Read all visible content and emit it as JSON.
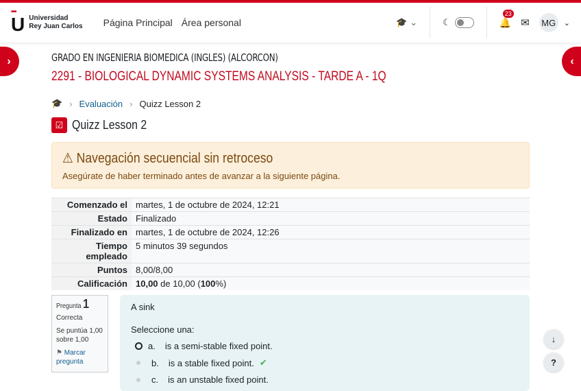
{
  "nav": {
    "logo_line1": "Universidad",
    "logo_line2": "Rey Juan Carlos",
    "links": [
      "Página Principal",
      "Área personal"
    ],
    "notifications": "23",
    "user_initials": "MG"
  },
  "header": {
    "degree": "GRADO EN INGENIERIA BIOMEDICA (INGLES) (ALCORCON)",
    "course": "2291 - BIOLOGICAL DYNAMIC SYSTEMS ANALYSIS - TARDE A - 1Q"
  },
  "breadcrumb": {
    "items": [
      "Evaluación",
      "Quizz Lesson 2"
    ]
  },
  "page_title": "Quizz Lesson 2",
  "alert": {
    "title": "Navegación secuencial sin retroceso",
    "text": "Asegúrate de haber terminado antes de avanzar a la siguiente página."
  },
  "summary": [
    {
      "label": "Comenzado el",
      "value": "martes, 1 de octubre de 2024, 12:21"
    },
    {
      "label": "Estado",
      "value": "Finalizado"
    },
    {
      "label": "Finalizado en",
      "value": "martes, 1 de octubre de 2024, 12:26"
    },
    {
      "label": "Tiempo empleado",
      "value": "5 minutos 39 segundos"
    },
    {
      "label": "Puntos",
      "value": "8,00/8,00"
    },
    {
      "label": "Calificación",
      "grade": "10,00",
      "of": " de 10,00 (",
      "pct": "100",
      "end": "%)"
    }
  ],
  "question": {
    "label": "Pregunta",
    "number": "1",
    "status": "Correcta",
    "score": "Se puntúa 1,00 sobre 1,00",
    "flag": "Marcar pregunta",
    "text": "A sink",
    "prompt": "Seleccione una:",
    "options": [
      {
        "letter": "a.",
        "text": "is a semi-stable fixed point."
      },
      {
        "letter": "b.",
        "text": "is a stable fixed point."
      },
      {
        "letter": "c.",
        "text": "is an unstable fixed point."
      }
    ]
  }
}
